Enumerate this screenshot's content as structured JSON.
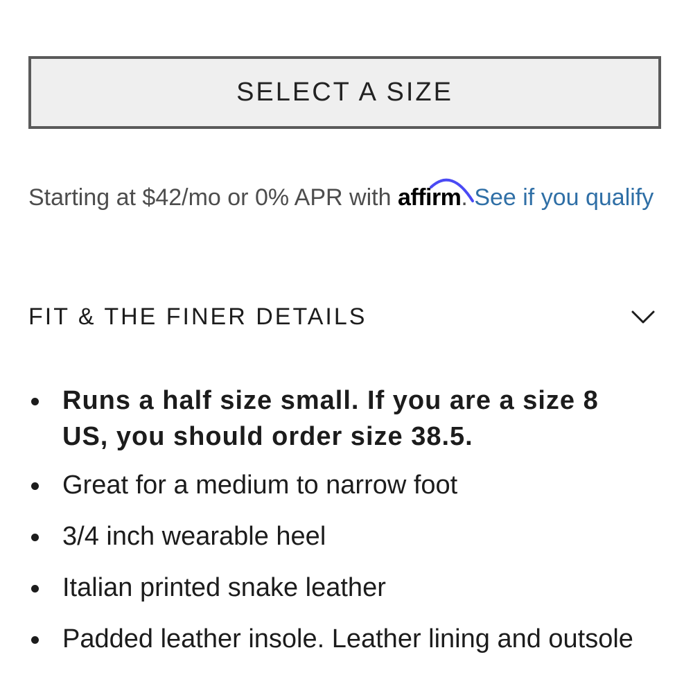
{
  "size_selector": {
    "label": "SELECT A SIZE"
  },
  "financing": {
    "prefix": "Starting at $42/mo or 0% APR with ",
    "brand": "affirm",
    "period": ". ",
    "link_label": "See if you qualify",
    "link_color": "#2f6fa6",
    "brand_arc_color": "#4a4af4"
  },
  "details": {
    "title": "FIT & THE FINER DETAILS",
    "toggle_icon": "chevron-down-icon",
    "items": [
      {
        "text": "Runs a half size small. If you are a size 8 US, you should order size 38.5.",
        "bold": true
      },
      {
        "text": "Great for a medium to narrow foot",
        "bold": false
      },
      {
        "text": "3/4 inch wearable heel",
        "bold": false
      },
      {
        "text": "Italian printed snake leather",
        "bold": false
      },
      {
        "text": "Padded leather insole. Leather lining and outsole",
        "bold": false
      }
    ]
  }
}
